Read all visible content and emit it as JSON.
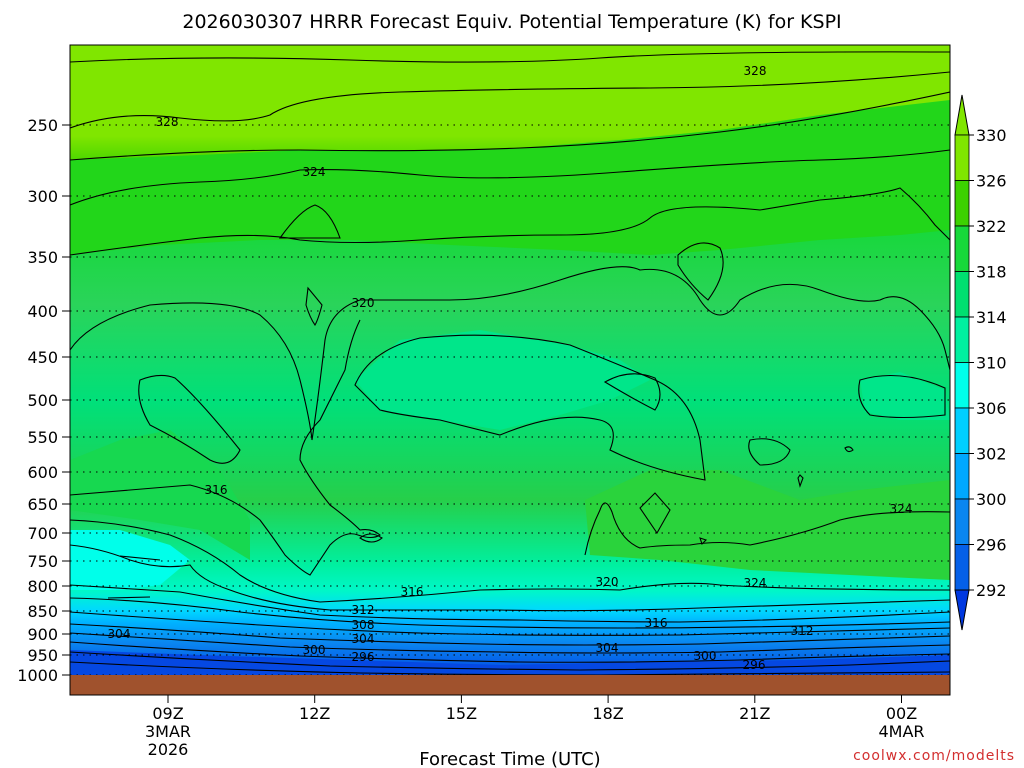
{
  "chart_data": {
    "type": "contour",
    "title": "2026030307 HRRR Forecast Equiv. Potential Temperature (K) for KSPI",
    "xlabel": "Forecast Time (UTC)",
    "ylabel": "",
    "credit": "coolwx.com/modelts",
    "y_axis": {
      "units": "hPa",
      "orientation": "inverted",
      "ticks": [
        250,
        300,
        350,
        400,
        450,
        500,
        550,
        600,
        650,
        700,
        750,
        800,
        850,
        900,
        950,
        1000
      ]
    },
    "x_axis": {
      "ticks": [
        {
          "hour": 9,
          "lines": [
            "09Z",
            "3MAR",
            "2026"
          ]
        },
        {
          "hour": 12,
          "lines": [
            "12Z"
          ]
        },
        {
          "hour": 15,
          "lines": [
            "15Z"
          ]
        },
        {
          "hour": 18,
          "lines": [
            "18Z"
          ]
        },
        {
          "hour": 21,
          "lines": [
            "21Z"
          ]
        },
        {
          "hour": 24,
          "lines": [
            "00Z",
            "4MAR"
          ]
        }
      ]
    },
    "colorbar": {
      "labels": [
        "330",
        "326",
        "322",
        "318",
        "314",
        "310",
        "306",
        "302",
        "300",
        "296",
        "292"
      ],
      "colors": [
        "#80e600",
        "#3cd200",
        "#17d83a",
        "#00e070",
        "#00f0a0",
        "#00ffea",
        "#00cfff",
        "#00a8ff",
        "#0a86f0",
        "#0560e8",
        "#0038e0"
      ]
    },
    "contour_labels": [
      "328",
      "328",
      "324",
      "324",
      "320",
      "320",
      "316",
      "316",
      "316",
      "312",
      "312",
      "308",
      "304",
      "304",
      "304",
      "300",
      "300",
      "296",
      "296",
      "324"
    ],
    "ground_color": "#a0522d"
  }
}
